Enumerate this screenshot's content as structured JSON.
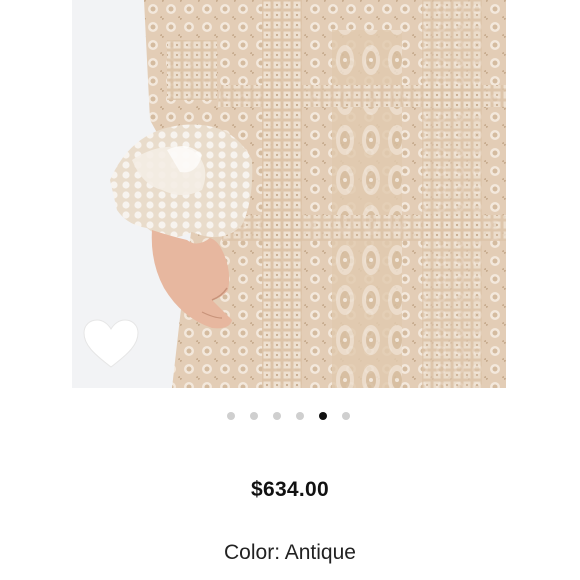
{
  "product": {
    "price": "$634.00",
    "color_label": "Color:",
    "color_value": "Antique"
  },
  "carousel": {
    "slide_count": 6,
    "active_index": 4
  },
  "icons": {
    "favorite": "heart-icon"
  },
  "colors": {
    "lace": "#e3cdb6",
    "lace_light": "#f1e5d7",
    "lace_dark": "#b9a084",
    "dot_inactive": "#cfcfcf",
    "dot_active": "#111111"
  }
}
